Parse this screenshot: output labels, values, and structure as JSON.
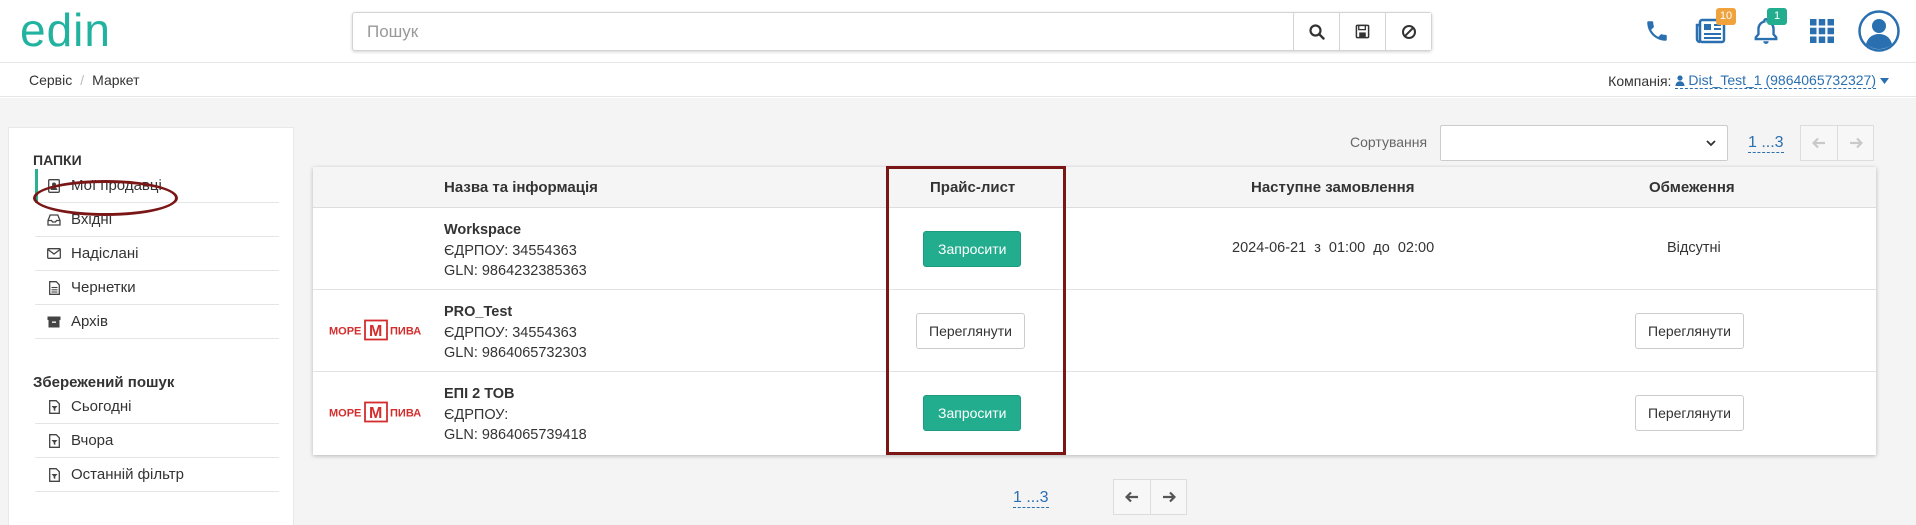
{
  "header": {
    "logo_text": "edin",
    "search": {
      "placeholder": "Пошук",
      "value": ""
    },
    "documents_badge": "10",
    "notifications_badge": "1"
  },
  "breadcrumb": {
    "items": [
      "Сервіс",
      "Маркет"
    ]
  },
  "company": {
    "label": "Компанія:",
    "value": "Dist_Test_1 (9864065732327)"
  },
  "sidebar": {
    "folders_title": "ПАПКИ",
    "folders": [
      {
        "label": "Мої продавці",
        "icon": "contact-card-icon"
      },
      {
        "label": "Вхідні",
        "icon": "inbox-icon"
      },
      {
        "label": "Надіслані",
        "icon": "envelope-icon"
      },
      {
        "label": "Чернетки",
        "icon": "document-icon"
      },
      {
        "label": "Архів",
        "icon": "archive-icon"
      }
    ],
    "saved_title": "Збережений пошук",
    "saved": [
      {
        "label": "Сьогодні",
        "icon": "filter-doc-icon"
      },
      {
        "label": "Вчора",
        "icon": "filter-doc-icon"
      },
      {
        "label": "Останній фільтр",
        "icon": "filter-doc-icon"
      }
    ]
  },
  "sorting": {
    "label": "Сортування",
    "value": ""
  },
  "pagination": {
    "label": "1 ...3"
  },
  "table": {
    "columns": [
      "Назва та інформація",
      "Прайс-лист",
      "Наступне замовлення",
      "Обмеження"
    ],
    "rows": [
      {
        "name": "Workspace",
        "edrpou": "ЄДРПОУ: 34554363",
        "gln": "GLN: 9864232385363",
        "price_action": "Запросити",
        "next_order": "2024-06-21  з  01:00  до  02:00",
        "restrictions": "Відсутні",
        "logo": ""
      },
      {
        "name": "PRO_Test",
        "edrpou": "ЄДРПОУ: 34554363",
        "gln": "GLN: 9864065732303",
        "price_action": "Переглянути",
        "next_order": "",
        "restrictions_action": "Переглянути",
        "logo": "МОРЕ М ПИВА"
      },
      {
        "name": "ЕПІ 2 ТОВ",
        "edrpou": "ЄДРПОУ:",
        "gln": "GLN: 9864065739418",
        "price_action": "Запросити",
        "next_order": "",
        "restrictions_action": "Переглянути",
        "logo": "МОРЕ М ПИВА"
      }
    ]
  },
  "colors": {
    "accent_green": "#22ad8e",
    "brand_teal": "#22b2a0",
    "link_blue": "#2a6fb0",
    "annotation": "#7a1616"
  }
}
